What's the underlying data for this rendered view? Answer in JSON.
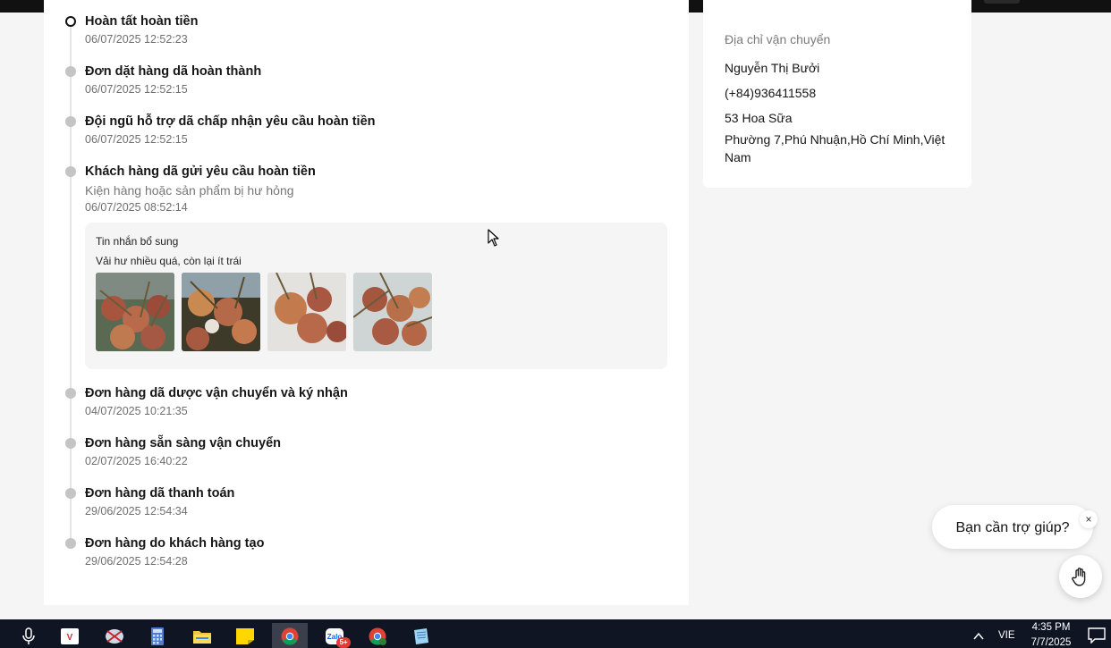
{
  "timeline": {
    "items": [
      {
        "title": "Hoàn tất hoàn tiền",
        "time": "06/07/2025 12:52:23"
      },
      {
        "title": "Đơn dặt hàng dã hoàn thành",
        "time": "06/07/2025 12:52:15"
      },
      {
        "title": "Đội ngũ hỗ trợ dã chấp nhận yêu cầu hoàn tiền",
        "time": "06/07/2025 12:52:15"
      },
      {
        "title": "Khách hàng dã gửi yêu cầu hoàn tiền",
        "reason": "Kiện hàng hoặc sản phẩm bị hư hỏng",
        "time": "06/07/2025 08:52:14"
      },
      {
        "title": "Đơn hàng dã dược vận chuyển và ký nhận",
        "time": "04/07/2025 10:21:35"
      },
      {
        "title": "Đơn hàng sẵn sàng vận chuyển",
        "time": "02/07/2025 16:40:22"
      },
      {
        "title": "Đơn hàng dã thanh toán",
        "time": "29/06/2025 12:54:34"
      },
      {
        "title": "Đơn hàng do khách hàng tạo",
        "time": "29/06/2025 12:54:28"
      }
    ],
    "message": {
      "label": "Tin nhắn bổ sung",
      "text": "Vải hư nhiều quá, còn lại ít trái",
      "photos": [
        "lychee-photo",
        "lychee-photo",
        "lychee-photo",
        "lychee-photo"
      ]
    }
  },
  "shipping": {
    "heading": "Địa chỉ vận chuyển",
    "name": "Nguyễn Thị Bưởi",
    "phone": "(+84)936411558",
    "street": "53 Hoa Sữa",
    "area": "Phường 7,Phú Nhuận,Hồ Chí Minh,Việt Nam"
  },
  "help": {
    "bubble_text": "Bạn cần trợ giúp?",
    "close_label": "×",
    "button_icon": "hand-wave-icon"
  },
  "taskbar": {
    "apps": [
      "microphone-icon",
      "unikey-icon",
      "snipping-tool-icon",
      "calculator-icon",
      "file-explorer-icon",
      "sticky-notes-icon",
      "chrome-icon",
      "zalo-icon",
      "chrome-profile-icon",
      "notepad-icon"
    ],
    "zalo_badge": "5+",
    "language": "VIE",
    "time": "4:35 PM",
    "date": "7/7/2025"
  },
  "colors": {
    "dot_inactive": "#c4c4c4",
    "taskbar": "#101523",
    "page_bg": "#f5f5f5"
  }
}
